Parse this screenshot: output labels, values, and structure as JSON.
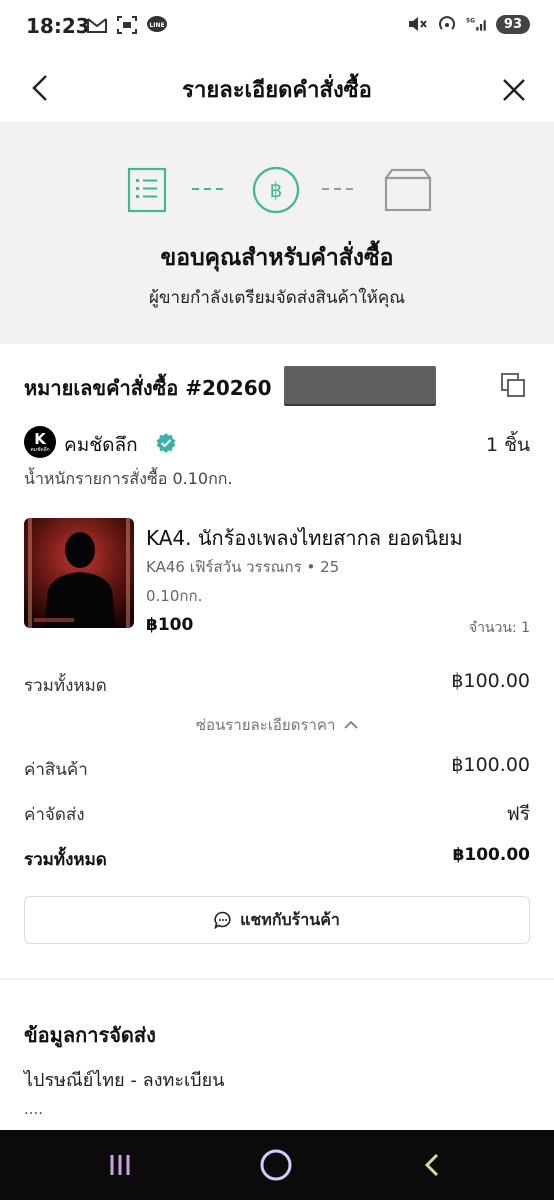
{
  "status_bar": {
    "time": "18:23",
    "battery": "93",
    "network": "5G",
    "left_icons": [
      "gmail-icon",
      "screenshot-icon",
      "line-icon"
    ],
    "right_icons": [
      "mute-icon",
      "hotspot-icon",
      "signal-icon"
    ]
  },
  "header": {
    "title": "รายละเอียดคำสั่งซื้อ"
  },
  "hero": {
    "title": "ขอบคุณสำหรับคำสั่งซื้อ",
    "subtitle": "ผู้ขายกำลังเตรียมจัดส่งสินค้าให้คุณ",
    "steps": [
      "order-list-icon",
      "baht-coin-icon",
      "box-icon"
    ],
    "active_color": "#3dbb8a",
    "inactive_color": "#9a9a9a",
    "active_step_count": 2
  },
  "order": {
    "number_label": "หมายเลขคำสั่งซื้อ #20260",
    "shop": {
      "logo_letter": "K",
      "logo_text": "คมชัดลึก",
      "name": "คมชัดลึก",
      "verified": true,
      "item_count": "1 ชิ้น"
    },
    "weight_label": "น้ำหนักรายการสั่งซื้อ 0.10กก.",
    "product": {
      "name": "KA4. นักร้องเพลงไทยสากล ยอดนิยม",
      "variant": "KA46 เฟิร์สวัน วรรณกร • 25",
      "weight": "0.10กก.",
      "price": "฿100",
      "quantity": "จำนวน: 1"
    },
    "summary": {
      "total_label": "รวมทั้งหมด",
      "total_value": "฿100.00",
      "toggle_label": "ซ่อนรายละเอียดราคา",
      "subtotal_label": "ค่าสินค้า",
      "subtotal_value": "฿100.00",
      "shipping_label": "ค่าจัดส่ง",
      "shipping_value": "ฟรี",
      "grand_total_label": "รวมทั้งหมด",
      "grand_total_value": "฿100.00"
    },
    "chat_button": "แชทกับร้านค้า"
  },
  "shipping": {
    "title": "ข้อมูลการจัดส่ง",
    "method": "ไปรษณีย์ไทย - ลงทะเบียน",
    "more": "...."
  },
  "nav": {
    "items": [
      "recent-apps-icon",
      "home-icon",
      "back-icon"
    ],
    "color": "#c9a3e0"
  }
}
